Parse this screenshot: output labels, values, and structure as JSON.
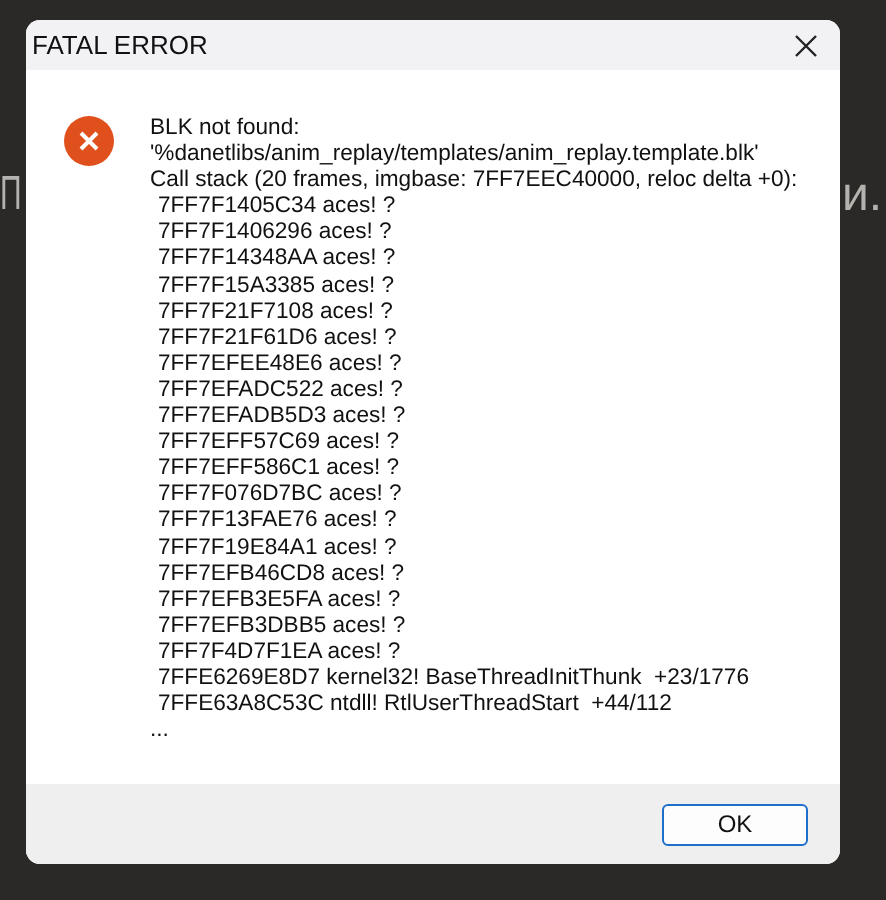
{
  "background_text": [
    "П",
    "и."
  ],
  "window": {
    "title": "FATAL ERROR"
  },
  "message": {
    "lines": [
      "BLK not found:",
      "'%danetlibs/anim_replay/templates/anim_replay.template.blk'",
      "Call stack (20 frames, imgbase: 7FF7EEC40000, reloc delta +0):"
    ],
    "frames": [
      "7FF7F1405C34 aces! ?",
      "7FF7F1406296 aces! ?",
      "7FF7F14348AA aces! ?",
      "7FF7F15A3385 aces! ?",
      "7FF7F21F7108 aces! ?",
      "7FF7F21F61D6 aces! ?",
      "7FF7EFEE48E6 aces! ?",
      "7FF7EFADC522 aces! ?",
      "7FF7EFADB5D3 aces! ?",
      "7FF7EFF57C69 aces! ?",
      "7FF7EFF586C1 aces! ?",
      "7FF7F076D7BC aces! ?",
      "7FF7F13FAE76 aces! ?",
      "7FF7F19E84A1 aces! ?",
      "7FF7EFB46CD8 aces! ?",
      "7FF7EFB3E5FA aces! ?",
      "7FF7EFB3DBB5 aces! ?",
      "7FF7F4D7F1EA aces! ?",
      "7FFE6269E8D7 kernel32! BaseThreadInitThunk  +23/1776",
      "7FFE63A8C53C ntdll! RtlUserThreadStart  +44/112"
    ],
    "ellipsis": "..."
  },
  "buttons": [
    {
      "label": "OK"
    }
  ]
}
